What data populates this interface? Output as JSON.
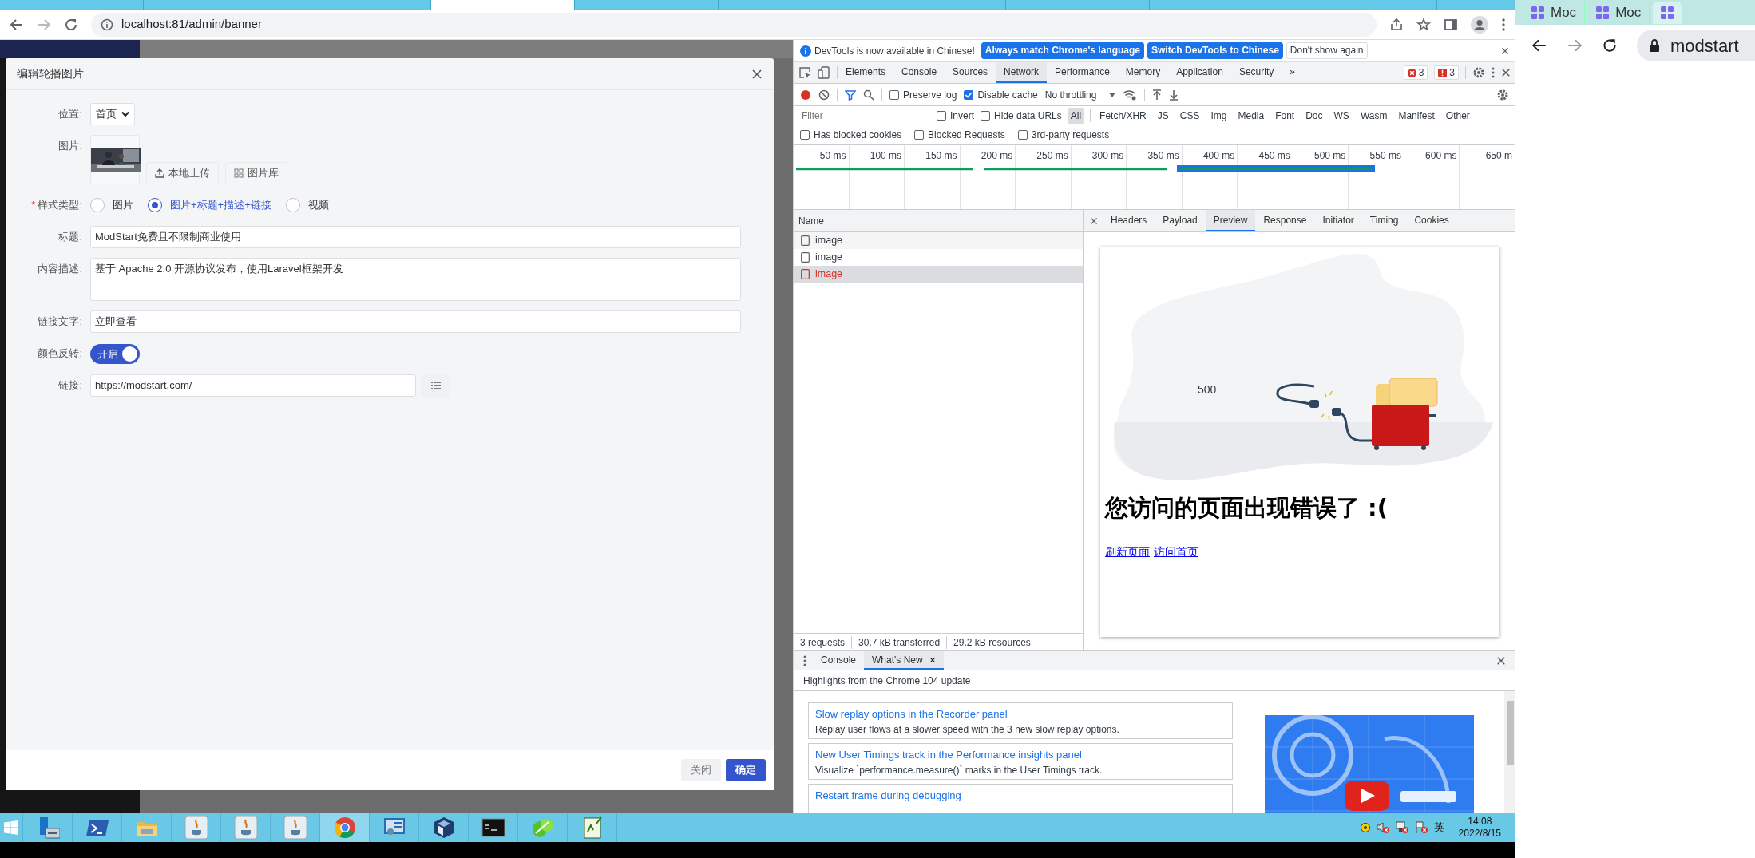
{
  "browser": {
    "tabs": [
      {
        "selected": false
      },
      {
        "selected": false
      },
      {
        "selected": false
      },
      {
        "selected": true
      },
      {
        "selected": false
      },
      {
        "selected": false
      },
      {
        "selected": false
      },
      {
        "selected": false
      },
      {
        "selected": false
      },
      {
        "selected": false
      }
    ],
    "url": "localhost:81/admin/banner"
  },
  "modal": {
    "title": "编辑轮播图片",
    "fields": [
      {
        "kind": "select",
        "label": "位置:",
        "value": "首页"
      },
      {
        "label": "图片:",
        "buttons": [
          "本地上传",
          "图片库"
        ]
      },
      {
        "kind": "radio",
        "label": "样式类型:",
        "required_mark": "*",
        "options": [
          {
            "label": "图片",
            "selected": false
          },
          {
            "label": "图片+标题+描述+链接",
            "selected": true
          },
          {
            "label": "视频",
            "selected": false
          }
        ]
      },
      {
        "kind": "text",
        "label": "标题:",
        "value": "ModStart免费且不限制商业使用"
      },
      {
        "kind": "textarea",
        "label": "内容描述:",
        "value": "基于 Apache 2.0 开源协议发布，使用Laravel框架开发"
      },
      {
        "kind": "text",
        "label": "链接文字:",
        "value": "立即查看"
      },
      {
        "kind": "switch",
        "label": "颜色反转:",
        "on": true,
        "text": "开启"
      },
      {
        "kind": "link",
        "label": "链接:",
        "value": "https://modstart.com/"
      }
    ],
    "buttons": [
      {
        "label": "关闭",
        "kind": "secondary"
      },
      {
        "label": "确定",
        "kind": "primary"
      }
    ]
  },
  "devtools": {
    "infobar": {
      "message": "DevTools is now available in Chinese!",
      "buttons": [
        {
          "label": "Always match Chrome's language",
          "kind": "primary"
        },
        {
          "label": "Switch DevTools to Chinese",
          "kind": "primary"
        },
        {
          "label": "Don't show again",
          "kind": "plain"
        }
      ]
    },
    "tabs": [
      {
        "label": "Elements",
        "selected": false
      },
      {
        "label": "Console",
        "selected": false
      },
      {
        "label": "Sources",
        "selected": false
      },
      {
        "label": "Network",
        "selected": true
      },
      {
        "label": "Performance",
        "selected": false
      },
      {
        "label": "Memory",
        "selected": false
      },
      {
        "label": "Application",
        "selected": false
      },
      {
        "label": "Security",
        "selected": false
      }
    ],
    "overflow": "»",
    "errors": "3",
    "issues": "3",
    "toolbar": {
      "recording": true,
      "checkboxes": [
        {
          "label": "Preserve log",
          "checked": false
        },
        {
          "label": "Disable cache",
          "checked": true
        }
      ],
      "throttling": "No throttling"
    },
    "filter": {
      "placeholder": "Filter",
      "checkboxes": [
        {
          "label": "Invert",
          "checked": false
        },
        {
          "label": "Hide data URLs",
          "checked": false
        }
      ],
      "types": [
        {
          "label": "All",
          "selected": true
        },
        {
          "label": "Fetch/XHR",
          "selected": false
        },
        {
          "label": "JS",
          "selected": false
        },
        {
          "label": "CSS",
          "selected": false
        },
        {
          "label": "Img",
          "selected": false
        },
        {
          "label": "Media",
          "selected": false
        },
        {
          "label": "Font",
          "selected": false
        },
        {
          "label": "Doc",
          "selected": false
        },
        {
          "label": "WS",
          "selected": false
        },
        {
          "label": "Wasm",
          "selected": false
        },
        {
          "label": "Manifest",
          "selected": false
        },
        {
          "label": "Other",
          "selected": false
        }
      ]
    },
    "more_filters": [
      {
        "label": "Has blocked cookies",
        "checked": false
      },
      {
        "label": "Blocked Requests",
        "checked": false
      },
      {
        "label": "3rd-party requests",
        "checked": false
      }
    ],
    "overview": {
      "ticks": [
        "50 ms",
        "100 ms",
        "150 ms",
        "200 ms",
        "250 ms",
        "300 ms",
        "350 ms",
        "400 ms",
        "450 ms",
        "500 ms",
        "550 ms",
        "600 ms",
        "650 m"
      ]
    },
    "requests": {
      "column": "Name",
      "rows": [
        {
          "name": "image",
          "selected": false,
          "failed": false
        },
        {
          "name": "image",
          "selected": false,
          "failed": false
        },
        {
          "name": "image",
          "selected": true,
          "failed": true
        }
      ]
    },
    "summary": [
      "3 requests",
      "30.7 kB transferred",
      "29.2 kB resources"
    ],
    "detail_tabs": [
      {
        "label": "Headers",
        "selected": false
      },
      {
        "label": "Payload",
        "selected": false
      },
      {
        "label": "Preview",
        "selected": true
      },
      {
        "label": "Response",
        "selected": false
      },
      {
        "label": "Initiator",
        "selected": false
      },
      {
        "label": "Timing",
        "selected": false
      },
      {
        "label": "Cookies",
        "selected": false
      }
    ],
    "preview": {
      "code": "500",
      "heading": "您访问的页面出现错误了 :(",
      "links": [
        "刷新页面",
        "访问首页"
      ]
    },
    "drawer": {
      "tabs": [
        {
          "label": "Console",
          "selected": false,
          "closable": false
        },
        {
          "label": "What's New",
          "selected": true,
          "closable": true
        }
      ],
      "headline": "Highlights from the Chrome 104 update",
      "items": [
        {
          "title": "Slow replay options in the Recorder panel",
          "description": "Replay user flows at a slower speed with the 3 new slow replay options."
        },
        {
          "title": "New User Timings track in the Performance insights panel",
          "description": "Visualize `performance.measure()` marks in the User Timings track."
        },
        {
          "title": "Restart frame during debugging"
        }
      ]
    }
  },
  "taskbar": {
    "ime": "英",
    "time": "14:08",
    "date": "2022/8/15"
  },
  "second_window": {
    "tabs": [
      {
        "label": "Moc",
        "selected": false
      },
      {
        "label": "Moc",
        "selected": false
      },
      {
        "selected": true
      }
    ],
    "url": "modstart"
  }
}
